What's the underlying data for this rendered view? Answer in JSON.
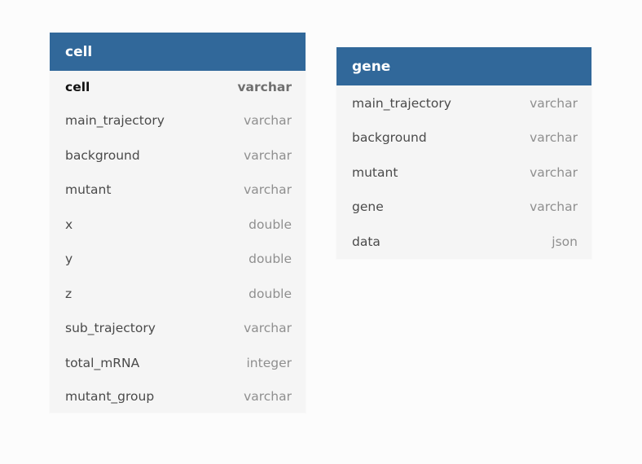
{
  "tables": [
    {
      "name": "cell",
      "columns": [
        {
          "name": "cell",
          "type": "varchar",
          "primary_key": true
        },
        {
          "name": "main_trajectory",
          "type": "varchar"
        },
        {
          "name": "background",
          "type": "varchar"
        },
        {
          "name": "mutant",
          "type": "varchar"
        },
        {
          "name": "x",
          "type": "double"
        },
        {
          "name": "y",
          "type": "double"
        },
        {
          "name": "z",
          "type": "double"
        },
        {
          "name": "sub_trajectory",
          "type": "varchar"
        },
        {
          "name": "total_mRNA",
          "type": "integer"
        },
        {
          "name": "mutant_group",
          "type": "varchar"
        }
      ]
    },
    {
      "name": "gene",
      "columns": [
        {
          "name": "main_trajectory",
          "type": "varchar"
        },
        {
          "name": "background",
          "type": "varchar"
        },
        {
          "name": "mutant",
          "type": "varchar"
        },
        {
          "name": "gene",
          "type": "varchar"
        },
        {
          "name": "data",
          "type": "json"
        }
      ]
    }
  ],
  "colors": {
    "header_bg": "#31689a",
    "header_text": "#ffffff",
    "table_bg": "#f5f5f5",
    "canvas_bg": "#fcfcfc",
    "column_name_text": "#4a4a4a",
    "column_type_text": "#8f8f8f"
  }
}
